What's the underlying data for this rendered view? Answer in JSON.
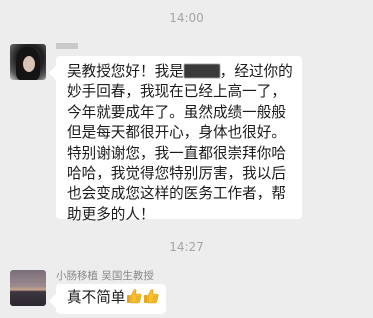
{
  "timestamps": [
    "14:00",
    "14:27"
  ],
  "messages": [
    {
      "sender_name": "",
      "lines": [
        [
          "吴教授您好！我是",
          "，经过你的"
        ],
        "妙手回春，我现在已经上高一了，",
        "今年就要成年了。虽然成绩一般般",
        "但是每天都很开心，身体也很好。",
        "特别谢谢您，我一直都很崇拜你哈",
        "哈哈，我觉得您特别厉害，我以后",
        "也会变成您这样的医务工作者，帮",
        "助更多的人！"
      ]
    },
    {
      "sender_name": "小肠移植 吴国生教授",
      "text": "真不简单",
      "emoji": [
        "thumbs-up-emoji",
        "thumbs-up-emoji"
      ]
    }
  ],
  "colors": {
    "background": "#ededed",
    "bubble": "#ffffff",
    "timestamp": "#a6a6a6",
    "name": "#888888",
    "thumb": "#f2b21a"
  }
}
